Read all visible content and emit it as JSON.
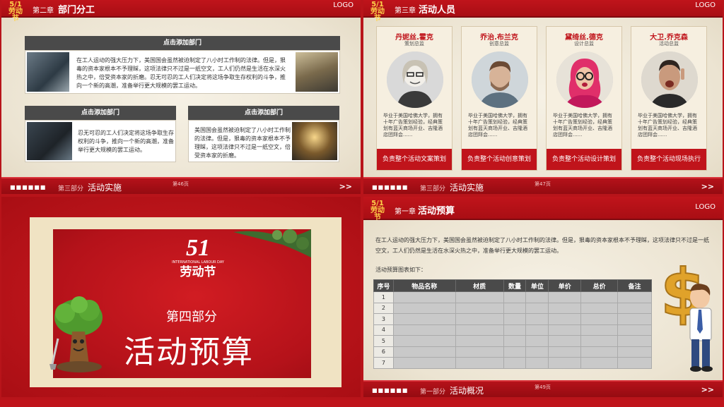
{
  "slide1": {
    "chapter": "第二章",
    "title": "部门分工",
    "logo": "LOGO",
    "top_box": {
      "heading": "点击添加部门",
      "text": "在工人运动的强大压力下，美国国会虽然被迫制定了八小时工作制的法律。但是，狠毒的资本家根本不予理睬，这项法律只不过是一纸空文，工人们仍然是生活在水深火热之中，倍受资本家的折磨。忍无可忍的工人们决定将这场争取生存权利的斗争，推向一个新的高潮，准备举行更大规模的罢工运动。"
    },
    "left_box": {
      "heading": "点击添加部门",
      "text": "忍无可忍的工人们决定将这场争取生存权利的斗争，推向一个新的高潮，准备举行更大规模的罢工运动。"
    },
    "right_box": {
      "heading": "点击添加部门",
      "text": "美国国会虽然被迫制定了八小时工作制的法律。但是，狠毒的资本家根本不予理睬，这项法律只不过是一纸空文，倍受资本家的折磨。"
    },
    "footer": {
      "dots": "■■■■■■",
      "part": "第三部分",
      "part_title": "活动实施",
      "page": "第46页",
      "arrow": ">>"
    }
  },
  "slide2": {
    "chapter": "第三章",
    "title": "活动人员",
    "logo": "LOGO",
    "people": [
      {
        "name": "丹妮丝.霍克",
        "role": "策划总监",
        "bio": "毕业于美国哈佛大学，拥有十年广告策划经验，经典策划有蓝天商场开业、吉隆酒店团拜会......",
        "duty": "负责整个活动文案策划"
      },
      {
        "name": "乔治.布兰克",
        "role": "创意总监",
        "bio": "毕业于美国哈佛大学，拥有十年广告策划经验，经典策划有蓝天商场开业、吉隆酒店团拜会......",
        "duty": "负责整个活动创意策划"
      },
      {
        "name": "黛绮丝.德克",
        "role": "设计总监",
        "bio": "毕业于美国哈佛大学，拥有十年广告策划经验，经典策划有蓝天商场开业、吉隆酒店团拜会......",
        "duty": "负责整个活动设计策划"
      },
      {
        "name": "大卫.乔克森",
        "role": "活动总监",
        "bio": "毕业于美国哈佛大学，拥有十年广告策划经验，经典策划有蓝天商场开业、吉隆酒店团拜会......",
        "duty": "负责整个活动现场执行"
      }
    ],
    "footer": {
      "dots": "■■■■■■",
      "part": "第三部分",
      "part_title": "活动实施",
      "page": "第47页",
      "arrow": ">>"
    }
  },
  "slide3": {
    "logo_num": "51",
    "logo_en": "INTERNATIONAL LABOUR DAY",
    "logo_cn": "劳动节",
    "part": "第四部分",
    "title": "活动预算"
  },
  "slide4": {
    "chapter": "第一章",
    "title": "活动预算",
    "logo": "LOGO",
    "intro": "在工人运动的强大压力下，美国国会虽然被迫制定了八小时工作制的法律。但是，狠毒的资本家根本不予理睬，这项法律只不过是一纸空文，工人们仍然是生活在水深火热之中，准备举行更大规模的罢工运动。",
    "table_caption": "活动预算图表如下：",
    "table": {
      "headers": [
        "序号",
        "物品名称",
        "材质",
        "数量",
        "单位",
        "单价",
        "总价",
        "备注"
      ],
      "rows": [
        "1",
        "2",
        "3",
        "4",
        "5",
        "6",
        "7"
      ]
    },
    "footer": {
      "dots": "■■■■■■",
      "part": "第一部分",
      "part_title": "活动概况",
      "page": "第49页",
      "arrow": ">>"
    }
  },
  "colors": {
    "brand_red": "#c0141b",
    "dark_gray": "#4a4a4a",
    "paper": "#efe9dc"
  }
}
